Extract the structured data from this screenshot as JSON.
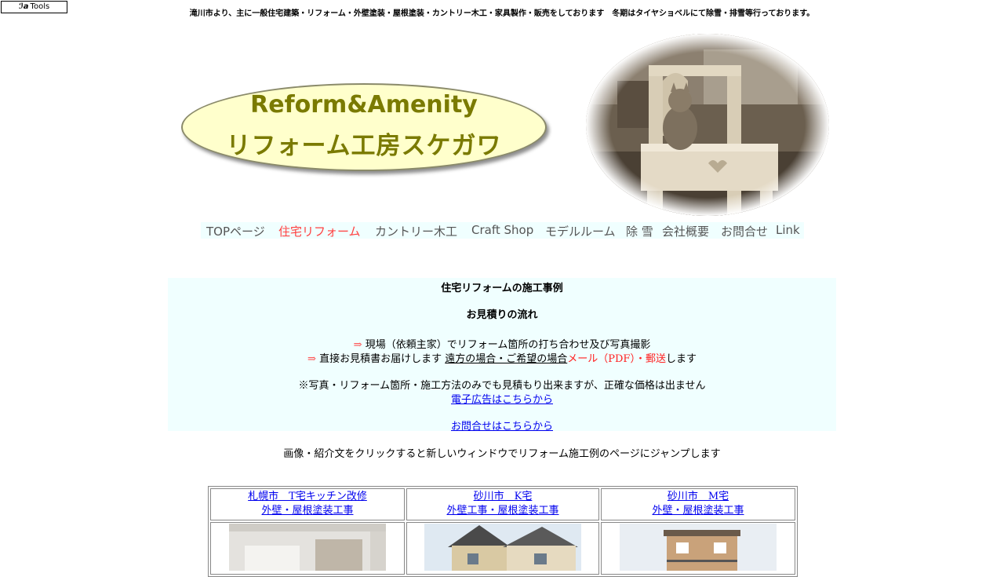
{
  "toolbar": {
    "tools_label": "Tools"
  },
  "header": {
    "tagline": "滝川市より、主に一般住宅建築・リフォーム・外壁塗装・屋根塗装・カントリー木工・家具製作・販売をしております　冬期はタイヤショベルにて除雪・排雪等行っております。",
    "logo_en": "Reform&Amenity",
    "logo_jp": "リフォーム工房スケガワ"
  },
  "nav": [
    {
      "label": "TOPページ"
    },
    {
      "label": "住宅リフォーム"
    },
    {
      "label": "カントリー木工"
    },
    {
      "label": "Craft Shop"
    },
    {
      "label": "モデルルーム"
    },
    {
      "label": "除 雪"
    },
    {
      "label": "会社概要"
    },
    {
      "label": "お問合せ"
    },
    {
      "label": "Link"
    }
  ],
  "info": {
    "title": "住宅リフォームの施工事例",
    "subtitle": "お見積りの流れ",
    "arrow": "⇒",
    "step1": "現場（依頼主家）でリフォーム箇所の打ち合わせ及び写真撮影",
    "step2_a": "直接お見積書お届けします",
    "step2_b": "遠方の場合・ご希望の場合",
    "step2_c": "メール（PDF）・郵送",
    "step2_d": "します",
    "note": "※写真・リフォーム箇所・施工方法のみでも見積もり出来ますが、正確な価格は出ません",
    "e_ad_link": "電子広告はこちらから",
    "contact_link": "お問合せはこちらから"
  },
  "notice": "画像・紹介文をクリックすると新しいウィンドウでリフォーム施工例のページにジャンプします",
  "cases": [
    {
      "line1": "札幌市　T宅キッチン改修",
      "line2": "外壁・屋根塗装工事"
    },
    {
      "line1": "砂川市　K宅",
      "line2": "外壁工事・屋根塗装工事"
    },
    {
      "line1": "砂川市　M宅",
      "line2": "外壁・屋根塗装工事"
    }
  ]
}
